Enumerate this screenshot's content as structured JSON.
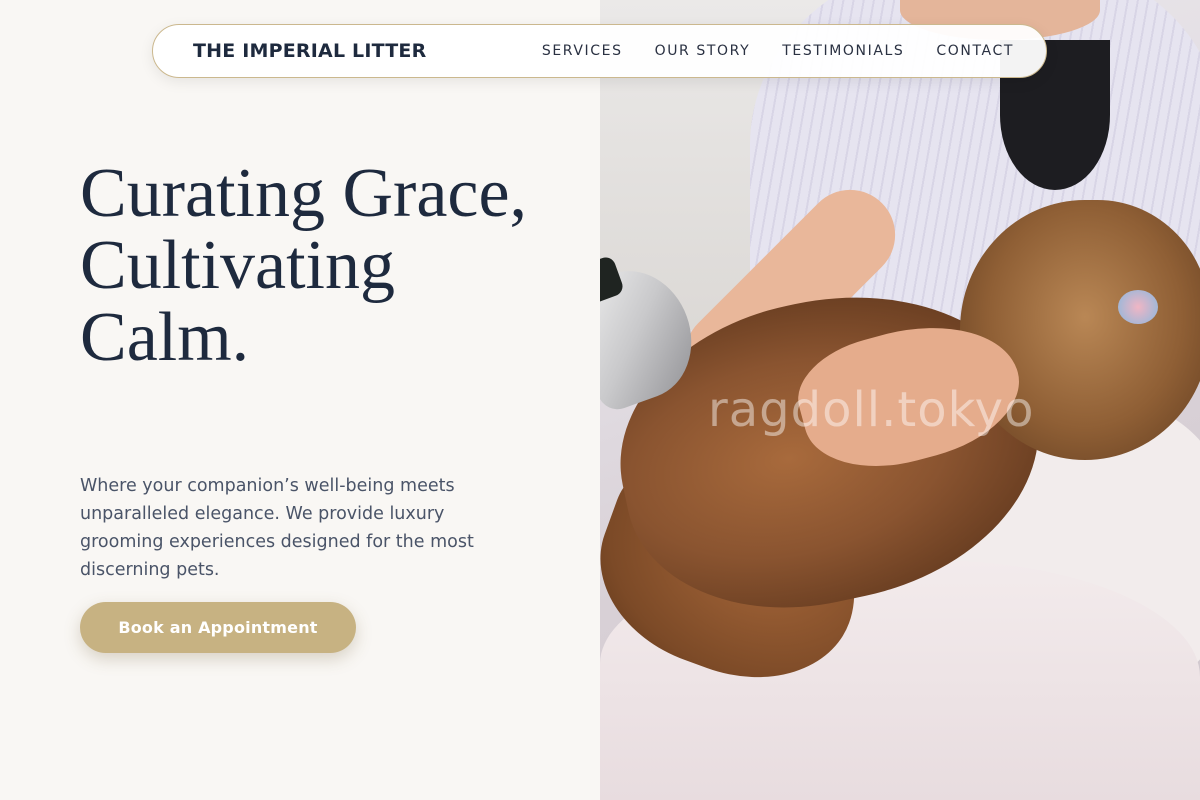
{
  "nav": {
    "brand": "THE IMPERIAL LITTER",
    "links": [
      "SERVICES",
      "OUR STORY",
      "TESTIMONIALS",
      "CONTACT"
    ]
  },
  "hero": {
    "title": "Curating Grace, Cultivating Calm.",
    "description": "Where your companion’s well-being meets unparalleled elegance. We provide luxury grooming experiences designed for the most discerning pets.",
    "cta_label": "Book an Appointment",
    "image_watermark": "ragdoll.tokyo"
  },
  "colors": {
    "accent": "#c7b282",
    "text_dark": "#1e2a3e",
    "text_muted": "#4a5468",
    "background": "#f9f7f4"
  }
}
